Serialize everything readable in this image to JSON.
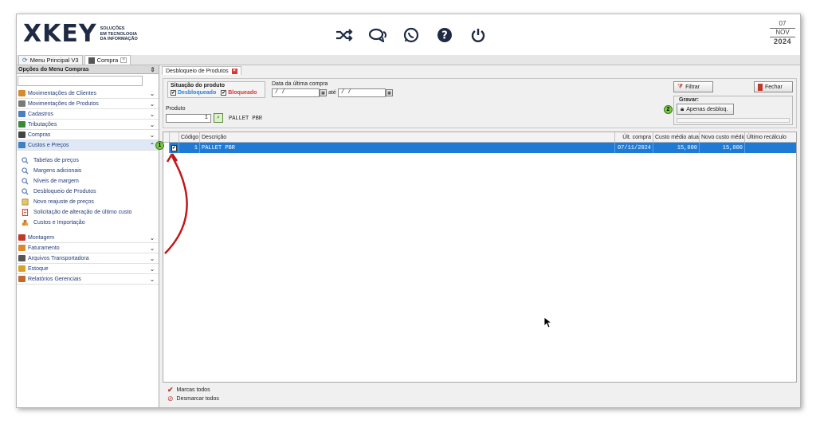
{
  "header": {
    "logo_mark": "XKEY",
    "logo_line1": "SOLUÇÕES",
    "logo_line2": "EM TECNOLOGIA",
    "logo_line3": "DA INFORMAÇÃO",
    "icons": [
      "shuffle-icon",
      "chat-icon",
      "whatsapp-icon",
      "help-icon",
      "power-icon"
    ],
    "date_day": "07",
    "date_month": "NOV",
    "date_year": "2024"
  },
  "main_tabs": [
    {
      "label": "Menu Principal V3"
    },
    {
      "label": "Compra"
    }
  ],
  "sidebar": {
    "title": "Opções do Menu Compras",
    "items_top": [
      {
        "label": "Movimentações de Clientes",
        "color": "#d98a2b"
      },
      {
        "label": "Movimentações de Produtos",
        "color": "#7a7a7a"
      },
      {
        "label": "Cadastros",
        "color": "#4a7fc1"
      },
      {
        "label": "Tributações",
        "color": "#3a8a3a"
      },
      {
        "label": "Compras",
        "color": "#444444"
      },
      {
        "label": "Custos e Preços",
        "color": "#3b82c4"
      }
    ],
    "sub_items": [
      {
        "label": "Tabelas de preços"
      },
      {
        "label": "Margens adicionais"
      },
      {
        "label": "Níveis de margem"
      },
      {
        "label": "Desbloqueio de Produtos"
      },
      {
        "label": "Novo reajuste de preços"
      },
      {
        "label": "Solicitação de alteração de último custo"
      },
      {
        "label": "Custos e Importação"
      }
    ],
    "items_bottom": [
      {
        "label": "Montagem",
        "color": "#c0392b"
      },
      {
        "label": "Faturamento",
        "color": "#d98a2b"
      },
      {
        "label": "Arquivos Transportadora",
        "color": "#555555"
      },
      {
        "label": "Estoque",
        "color": "#d9a02b"
      },
      {
        "label": "Relatórios Gerenciais",
        "color": "#c06a2b"
      }
    ]
  },
  "content": {
    "tab_label": "Desbloqueio de Produtos",
    "situacao_label": "Situação do produto",
    "desbloqueado_label": "Desbloqueado",
    "bloqueado_label": "Bloqueado",
    "data_label": "Data da última compra",
    "date_from": " /  /",
    "ate_label": "até",
    "date_to": " /  /",
    "produto_label": "Produto",
    "produto_code": "1",
    "produto_name": "PALLET PBR",
    "filtrar_label": "Filtrar",
    "fechar_label": "Fechar",
    "gravar_label": "Gravar:",
    "apenas_label": "Apenas desbloq.",
    "badge1": "1",
    "badge2": "2"
  },
  "grid": {
    "columns": [
      "",
      "Código",
      "Descrição",
      "Últ. compra",
      "Custo médio atual",
      "Novo custo médio",
      "Último recálculo"
    ],
    "rows": [
      {
        "checked": "✔",
        "codigo": "1",
        "descricao": "PALLET PBR",
        "ult_compra": "07/11/2024",
        "custo_atual": "15,000",
        "novo_custo": "15,000",
        "recalculo": ""
      }
    ]
  },
  "footer": {
    "marcar_label": "Marcas todos",
    "desmarcar_label": "Desmarcar todos"
  }
}
